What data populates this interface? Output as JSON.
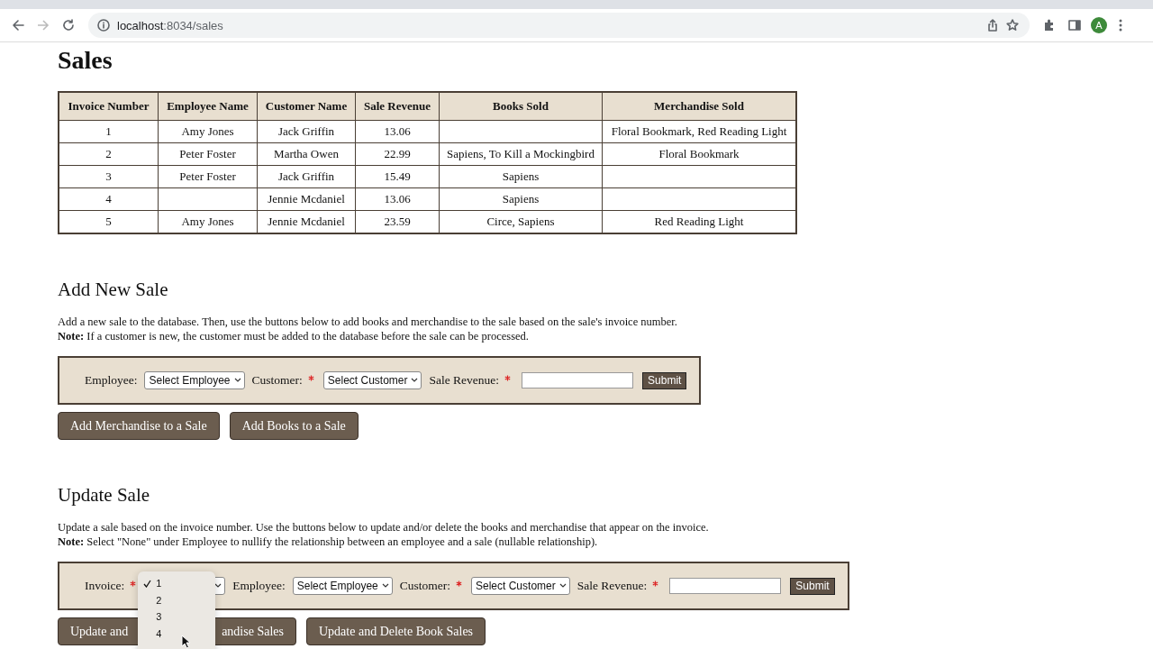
{
  "browser": {
    "url_host": "localhost",
    "url_path": ":8034/sales",
    "avatar": "A"
  },
  "sales": {
    "title": "Sales",
    "columns": [
      "Invoice Number",
      "Employee Name",
      "Customer Name",
      "Sale Revenue",
      "Books Sold",
      "Merchandise Sold"
    ],
    "rows": [
      [
        "1",
        "Amy Jones",
        "Jack Griffin",
        "13.06",
        "",
        "Floral Bookmark, Red Reading Light"
      ],
      [
        "2",
        "Peter Foster",
        "Martha Owen",
        "22.99",
        "Sapiens, To Kill a Mockingbird",
        "Floral Bookmark"
      ],
      [
        "3",
        "Peter Foster",
        "Jack Griffin",
        "15.49",
        "Sapiens",
        ""
      ],
      [
        "4",
        "",
        "Jennie Mcdaniel",
        "13.06",
        "Sapiens",
        ""
      ],
      [
        "5",
        "Amy Jones",
        "Jennie Mcdaniel",
        "23.59",
        "Circe, Sapiens",
        "Red Reading Light"
      ]
    ]
  },
  "add_sale": {
    "title": "Add New Sale",
    "description": "Add a new sale to the database. Then, use the buttons below to add books and merchandise to the sale based on the sale's invoice number.",
    "note": "**Note:** If a customer is new, the customer must be added to the database before the sale can be processed.",
    "fields": [
      {
        "kind": "select",
        "label": "Employee:",
        "required": false,
        "value": "Select Employee"
      },
      {
        "kind": "select",
        "label": "Customer:",
        "required": true,
        "value": "Select Customer"
      },
      {
        "kind": "text",
        "label": "Sale Revenue:",
        "required": true
      }
    ],
    "submit": "Submit",
    "buttons": [
      "Add Merchandise to a Sale",
      "Add Books to a Sale"
    ]
  },
  "update_sale": {
    "title": "Update Sale",
    "description": "Update a sale based on the invoice number. Use the buttons below to update and/or delete the books and merchandise that appear on the invoice.",
    "note": "**Note:** Select \"None\" under Employee to nullify the relationship between an employee and a sale (nullable relationship).",
    "fields": [
      {
        "kind": "select",
        "label": "Invoice:",
        "required": true,
        "open": true
      },
      {
        "kind": "select",
        "label": "Employee:",
        "required": false,
        "value": "Select Employee"
      },
      {
        "kind": "select",
        "label": "Customer:",
        "required": true,
        "value": "Select Customer"
      },
      {
        "kind": "text",
        "label": "Sale Revenue:",
        "required": true
      }
    ],
    "submit": "Submit",
    "buttons": [
      {
        "label_start": "Update and",
        "label_end": "andise Sales"
      },
      {
        "label_start": "Update and Delete Book Sales"
      }
    ],
    "invoice_options": [
      {
        "label": "1",
        "selected": true
      },
      {
        "label": "2",
        "selected": false
      },
      {
        "label": "3",
        "selected": false
      },
      {
        "label": "4",
        "selected": false
      }
    ]
  }
}
